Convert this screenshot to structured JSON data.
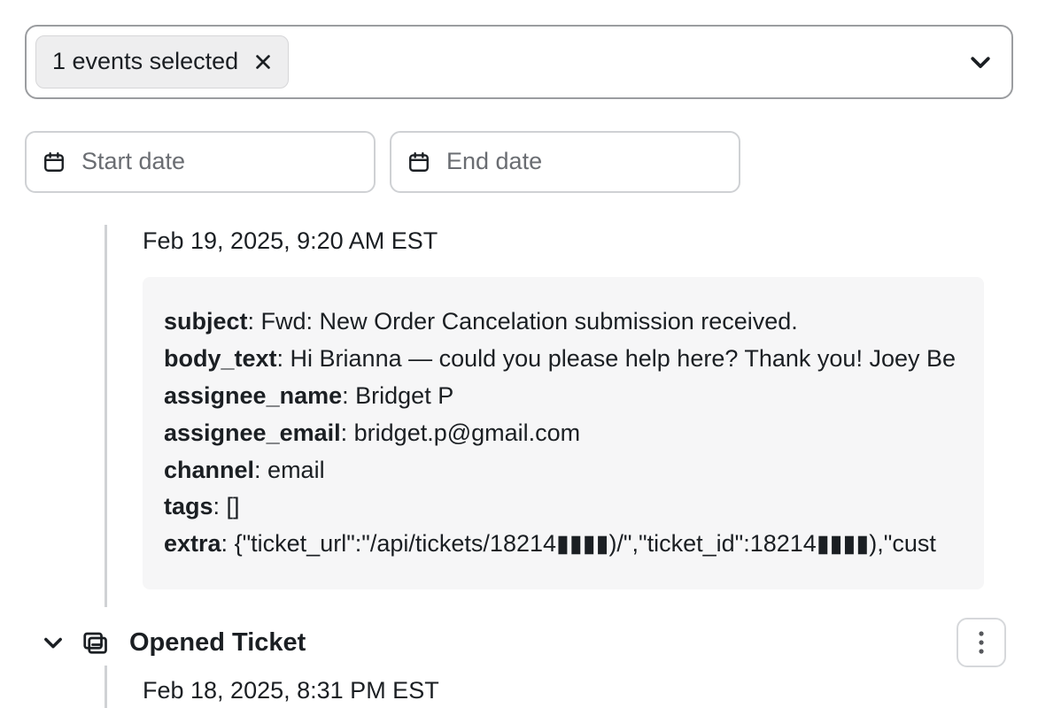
{
  "filter": {
    "chip_label": "1 events selected"
  },
  "dates": {
    "start_placeholder": "Start date",
    "end_placeholder": "End date"
  },
  "events": [
    {
      "timestamp": "Feb 19, 2025, 9:20 AM EST",
      "fields": {
        "subject_key": "subject",
        "subject_val": "Fwd: New Order Cancelation submission received.",
        "body_key": "body_text",
        "body_val": "Hi Brianna — could you please help here? Thank you! Joey Be",
        "assignee_name_key": "assignee_name",
        "assignee_name_val": "Bridget P",
        "assignee_email_key": "assignee_email",
        "assignee_email_val": "bridget.p@gmail.com",
        "channel_key": "channel",
        "channel_val": "email",
        "tags_key": "tags",
        "tags_val": "[]",
        "extra_key": "extra",
        "extra_val": "{\"ticket_url\":\"/api/tickets/18214▮▮▮▮)/\",\"ticket_id\":18214▮▮▮▮),\"cust"
      }
    },
    {
      "title": "Opened Ticket",
      "timestamp": "Feb 18, 2025, 8:31 PM EST"
    }
  ]
}
